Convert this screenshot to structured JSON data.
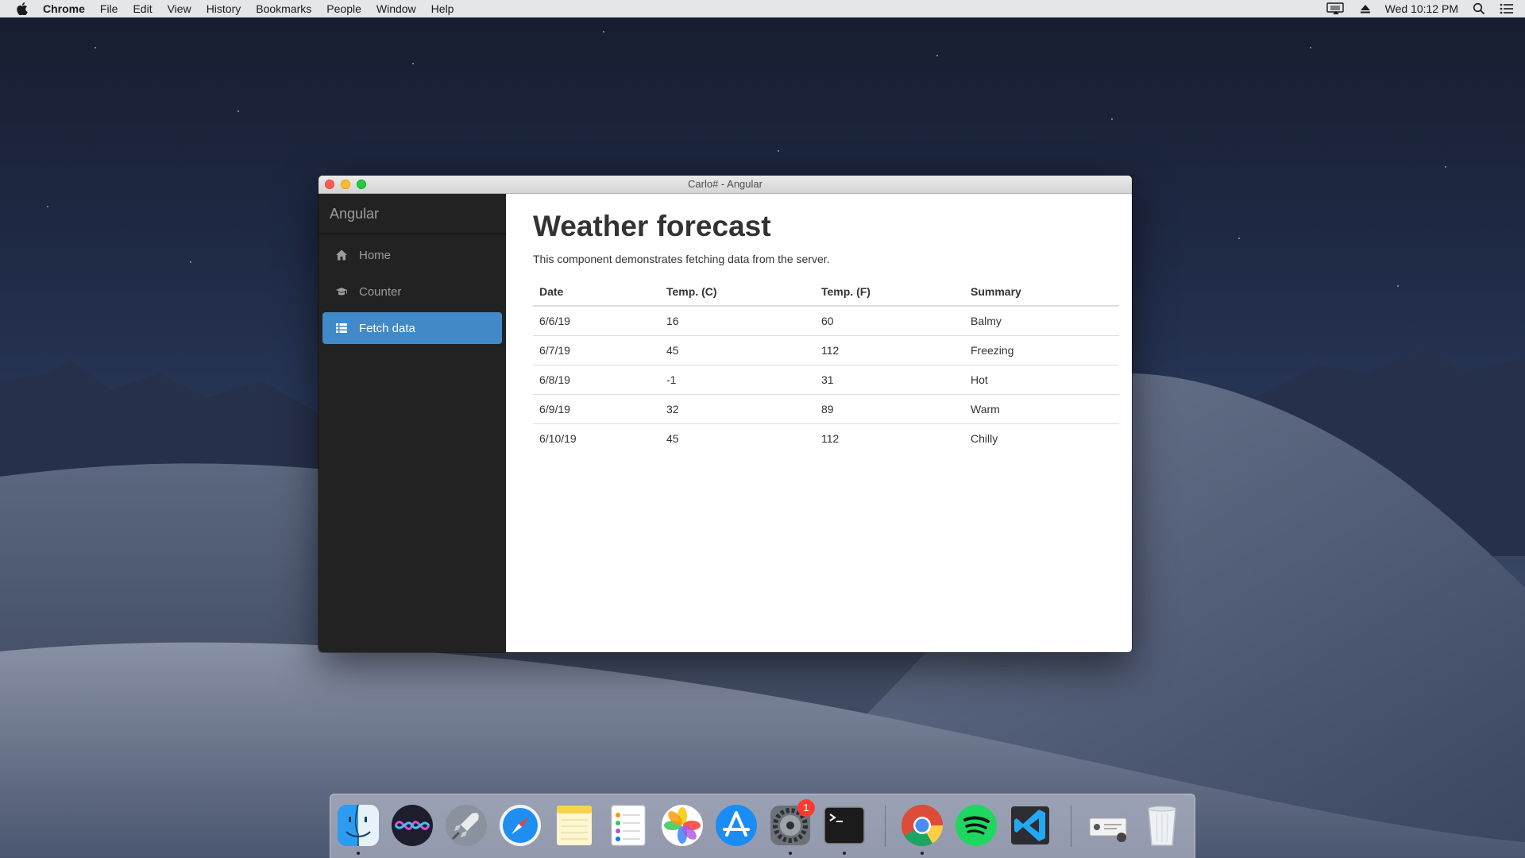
{
  "menubar": {
    "app_name": "Chrome",
    "items": [
      "File",
      "Edit",
      "View",
      "History",
      "Bookmarks",
      "People",
      "Window",
      "Help"
    ],
    "clock": "Wed 10:12 PM"
  },
  "window": {
    "title": "Carlo# - Angular"
  },
  "sidebar": {
    "brand": "Angular",
    "items": [
      {
        "label": "Home",
        "icon": "home-icon",
        "active": false
      },
      {
        "label": "Counter",
        "icon": "graduation-cap-icon",
        "active": false
      },
      {
        "label": "Fetch data",
        "icon": "list-icon",
        "active": true
      }
    ],
    "active_color": "#4189c7"
  },
  "main": {
    "title": "Weather forecast",
    "description": "This component demonstrates fetching data from the server.",
    "table": {
      "headers": [
        "Date",
        "Temp. (C)",
        "Temp. (F)",
        "Summary"
      ],
      "rows": [
        [
          "6/6/19",
          "16",
          "60",
          "Balmy"
        ],
        [
          "6/7/19",
          "45",
          "112",
          "Freezing"
        ],
        [
          "6/8/19",
          "-1",
          "31",
          "Hot"
        ],
        [
          "6/9/19",
          "32",
          "89",
          "Warm"
        ],
        [
          "6/10/19",
          "45",
          "112",
          "Chilly"
        ]
      ]
    }
  },
  "dock": {
    "apps": [
      {
        "name": "finder-icon",
        "running": true
      },
      {
        "name": "siri-icon",
        "running": false
      },
      {
        "name": "launchpad-icon",
        "running": false
      },
      {
        "name": "safari-icon",
        "running": false
      },
      {
        "name": "notes-icon",
        "running": false
      },
      {
        "name": "reminders-icon",
        "running": false
      },
      {
        "name": "photos-icon",
        "running": false
      },
      {
        "name": "app-store-icon",
        "running": false
      },
      {
        "name": "system-preferences-icon",
        "running": true,
        "badge": "1"
      },
      {
        "name": "terminal-icon",
        "running": true
      },
      {
        "name": "chrome-icon",
        "running": true
      },
      {
        "name": "spotify-icon",
        "running": false
      },
      {
        "name": "vscode-icon",
        "running": false
      },
      {
        "name": "downloads-stack-icon",
        "running": false
      },
      {
        "name": "trash-icon",
        "running": false
      }
    ]
  }
}
